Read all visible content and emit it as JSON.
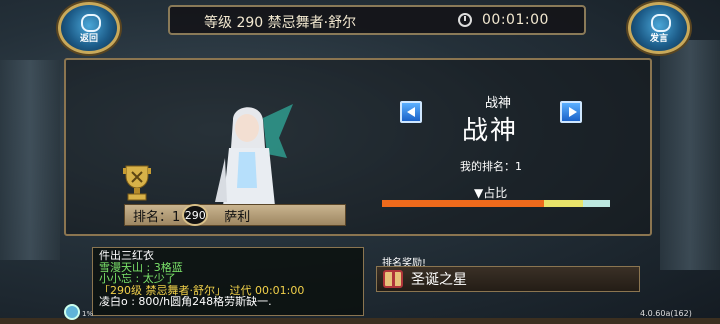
{
  "header": {
    "level_title": "等级 290 禁忌舞者·舒尔",
    "timer": "00:01:00"
  },
  "left_button": {
    "label": "返回"
  },
  "right_button": {
    "label": "发言"
  },
  "ranking": {
    "category_small": "战神",
    "category_big": "战神",
    "my_rank_label": "我的排名：1",
    "percent_label": "▼占比",
    "rank_label": "排名：1",
    "level_badge": "290",
    "player_name": "萨利",
    "bar_segments": [
      {
        "fraction": 0.71,
        "color": "#ee6a1c"
      },
      {
        "fraction": 0.17,
        "color": "#e8e36a"
      },
      {
        "fraction": 0.12,
        "color": "#bde8e0"
      }
    ]
  },
  "chat": {
    "lines": [
      {
        "text": "件出三红衣",
        "color": "#ffffff"
      },
      {
        "text": "雪漫天山           : 3格蓝",
        "color": "#7be36a"
      },
      {
        "text": "小小忘              : 太少了",
        "color": "#7be36a"
      },
      {
        "text": "「290级 禁忌舞者·舒尔」 过代 00:01:00",
        "color": "#f1d04a"
      },
      {
        "text": "凌白o              : 800/h圆角248格劳斯缺一.",
        "color": "#ffffff"
      }
    ]
  },
  "reward": {
    "label": "排名奖励!",
    "item": "圣诞之星"
  },
  "status": {
    "percent": "1%"
  },
  "version": "4.0.60a(162)"
}
